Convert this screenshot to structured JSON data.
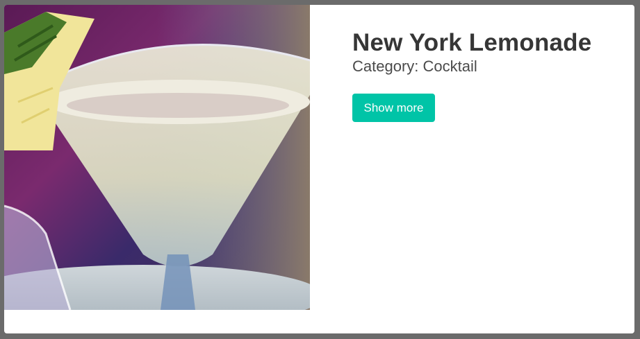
{
  "drink": {
    "name": "New York Lemonade",
    "category": "Category: Cocktail",
    "image_icon": "cocktail-photo"
  },
  "actions": {
    "show_more_label": "Show more"
  },
  "colors": {
    "button": "#00c4a7",
    "card": "#ffffff",
    "backdrop": "#6b6b6b"
  }
}
